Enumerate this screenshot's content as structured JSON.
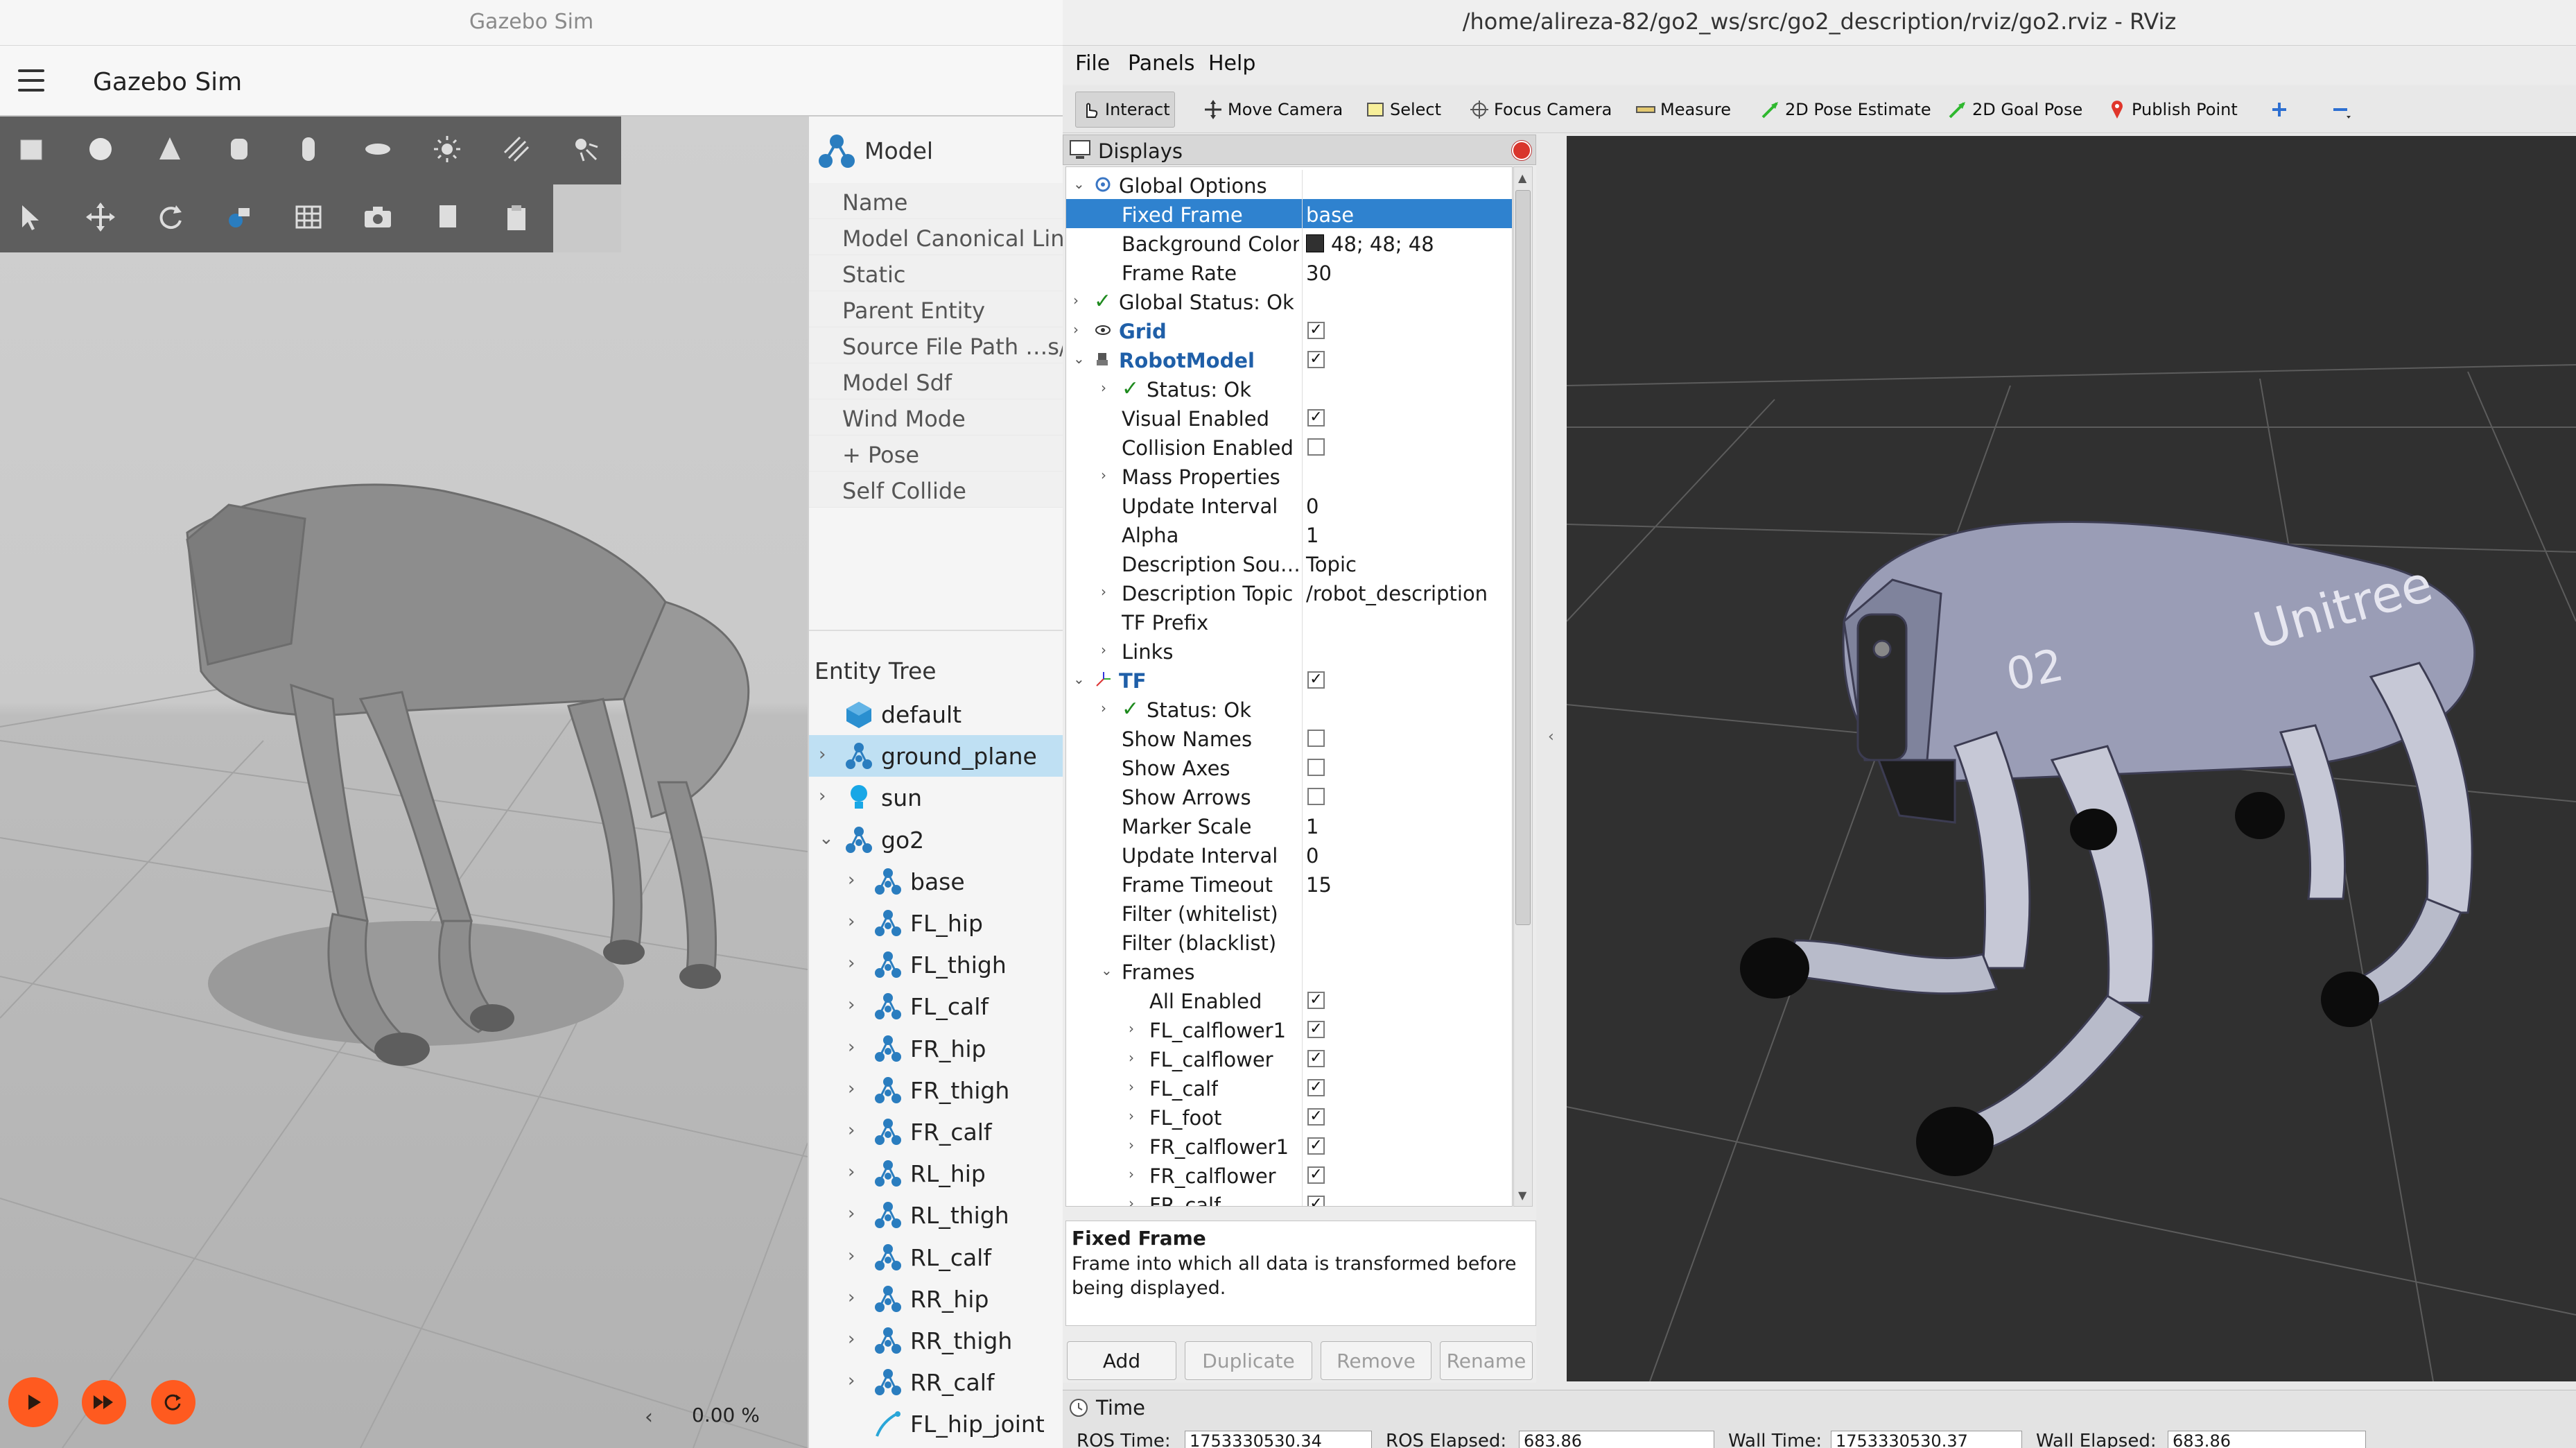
{
  "gazebo": {
    "window_title": "Gazebo Sim",
    "app_title": "Gazebo Sim",
    "toolbar_icons": [
      "box-icon",
      "sphere-icon",
      "cone-icon",
      "cylinder-icon",
      "capsule-icon",
      "ellipsoid-icon",
      "light-icon",
      "directional-light-icon",
      "spot-light-icon",
      "select-icon",
      "translate-icon",
      "rotate-icon",
      "transform-icon",
      "grid-icon",
      "camera-icon",
      "copy-icon",
      "paste-icon"
    ],
    "rtf": "0.00 %",
    "controls": [
      "play-icon",
      "step-icon",
      "reset-icon"
    ],
    "component_inspector": {
      "title": "Model",
      "properties": [
        "Name",
        "Model Canonical Link",
        "Static",
        "Parent Entity",
        "Source File Path  …s/g",
        "Model Sdf",
        "Wind Mode",
        "+ Pose",
        "Self Collide"
      ]
    },
    "entity_tree": {
      "title": "Entity Tree",
      "items": [
        {
          "label": "default",
          "icon": "world-icon",
          "level": 0,
          "expand": ""
        },
        {
          "label": "ground_plane",
          "icon": "model-icon",
          "level": 0,
          "expand": "›",
          "selected": true
        },
        {
          "label": "sun",
          "icon": "light-bulb-icon",
          "level": 0,
          "expand": "›"
        },
        {
          "label": "go2",
          "icon": "model-icon",
          "level": 0,
          "expand": "⌄"
        },
        {
          "label": "base",
          "icon": "link-icon",
          "level": 1,
          "expand": "›"
        },
        {
          "label": "FL_hip",
          "icon": "link-icon",
          "level": 1,
          "expand": "›"
        },
        {
          "label": "FL_thigh",
          "icon": "link-icon",
          "level": 1,
          "expand": "›"
        },
        {
          "label": "FL_calf",
          "icon": "link-icon",
          "level": 1,
          "expand": "›"
        },
        {
          "label": "FR_hip",
          "icon": "link-icon",
          "level": 1,
          "expand": "›"
        },
        {
          "label": "FR_thigh",
          "icon": "link-icon",
          "level": 1,
          "expand": "›"
        },
        {
          "label": "FR_calf",
          "icon": "link-icon",
          "level": 1,
          "expand": "›"
        },
        {
          "label": "RL_hip",
          "icon": "link-icon",
          "level": 1,
          "expand": "›"
        },
        {
          "label": "RL_thigh",
          "icon": "link-icon",
          "level": 1,
          "expand": "›"
        },
        {
          "label": "RL_calf",
          "icon": "link-icon",
          "level": 1,
          "expand": "›"
        },
        {
          "label": "RR_hip",
          "icon": "link-icon",
          "level": 1,
          "expand": "›"
        },
        {
          "label": "RR_thigh",
          "icon": "link-icon",
          "level": 1,
          "expand": "›"
        },
        {
          "label": "RR_calf",
          "icon": "link-icon",
          "level": 1,
          "expand": "›"
        },
        {
          "label": "FL_hip_joint",
          "icon": "joint-icon",
          "level": 1,
          "expand": ""
        }
      ]
    }
  },
  "rviz": {
    "window_title": "/home/alireza-82/go2_ws/src/go2_description/rviz/go2.rviz - RViz",
    "menus": [
      "File",
      "Panels",
      "Help"
    ],
    "tools": [
      "Interact",
      "Move Camera",
      "Select",
      "Focus Camera",
      "Measure",
      "2D Pose Estimate",
      "2D Goal Pose",
      "Publish Point"
    ],
    "displays_title": "Displays",
    "tree": [
      {
        "label": "Global Options",
        "level": 0,
        "exp": "⌄",
        "icon": "gear"
      },
      {
        "label": "Fixed Frame",
        "level": 1,
        "value": "base",
        "selected": true
      },
      {
        "label": "Background Color",
        "level": 1,
        "value": "48; 48; 48",
        "swatch": "#303030"
      },
      {
        "label": "Frame Rate",
        "level": 1,
        "value": "30"
      },
      {
        "label": "Global Status: Ok",
        "level": 0,
        "exp": "›",
        "check": true
      },
      {
        "label": "Grid",
        "level": 0,
        "exp": "›",
        "bold": true,
        "cb": true,
        "icon": "grid"
      },
      {
        "label": "RobotModel",
        "level": 0,
        "exp": "⌄",
        "bold": true,
        "cb": true,
        "icon": "robot"
      },
      {
        "label": "Status: Ok",
        "level": 1,
        "exp": "›",
        "check": true
      },
      {
        "label": "Visual Enabled",
        "level": 1,
        "cb": true
      },
      {
        "label": "Collision Enabled",
        "level": 1,
        "cb": false
      },
      {
        "label": "Mass Properties",
        "level": 1,
        "exp": "›"
      },
      {
        "label": "Update Interval",
        "level": 1,
        "value": "0"
      },
      {
        "label": "Alpha",
        "level": 1,
        "value": "1"
      },
      {
        "label": "Description Sou…",
        "level": 1,
        "value": "Topic"
      },
      {
        "label": "Description Topic",
        "level": 1,
        "exp": "›",
        "value": "/robot_description"
      },
      {
        "label": "TF Prefix",
        "level": 1
      },
      {
        "label": "Links",
        "level": 1,
        "exp": "›"
      },
      {
        "label": "TF",
        "level": 0,
        "exp": "⌄",
        "bold": true,
        "cb": true,
        "icon": "tf"
      },
      {
        "label": "Status: Ok",
        "level": 1,
        "exp": "›",
        "check": true
      },
      {
        "label": "Show Names",
        "level": 1,
        "cb": false
      },
      {
        "label": "Show Axes",
        "level": 1,
        "cb": false
      },
      {
        "label": "Show Arrows",
        "level": 1,
        "cb": false
      },
      {
        "label": "Marker Scale",
        "level": 1,
        "value": "1"
      },
      {
        "label": "Update Interval",
        "level": 1,
        "value": "0"
      },
      {
        "label": "Frame Timeout",
        "level": 1,
        "value": "15"
      },
      {
        "label": "Filter (whitelist)",
        "level": 1
      },
      {
        "label": "Filter (blacklist)",
        "level": 1
      },
      {
        "label": "Frames",
        "level": 1,
        "exp": "⌄"
      },
      {
        "label": "All Enabled",
        "level": 2,
        "cb": true
      },
      {
        "label": "FL_calflower1",
        "level": 2,
        "exp": "›",
        "cb": true
      },
      {
        "label": "FL_calflower",
        "level": 2,
        "exp": "›",
        "cb": true
      },
      {
        "label": "FL_calf",
        "level": 2,
        "exp": "›",
        "cb": true
      },
      {
        "label": "FL_foot",
        "level": 2,
        "exp": "›",
        "cb": true
      },
      {
        "label": "FR_calflower1",
        "level": 2,
        "exp": "›",
        "cb": true
      },
      {
        "label": "FR_calflower",
        "level": 2,
        "exp": "›",
        "cb": true
      },
      {
        "label": "FR_calf",
        "level": 2,
        "exp": "›",
        "cb": true
      }
    ],
    "description": {
      "title": "Fixed Frame",
      "body": "Frame into which all data is transformed before being displayed."
    },
    "buttons": [
      {
        "label": "Add",
        "enabled": true
      },
      {
        "label": "Duplicate",
        "enabled": false
      },
      {
        "label": "Remove",
        "enabled": false
      },
      {
        "label": "Rename",
        "enabled": false
      }
    ],
    "viewport": {
      "robot_label": "Unitree",
      "robot_id": "02"
    },
    "time": {
      "title": "Time",
      "fields": [
        {
          "label": "ROS Time:",
          "value": "1753330530.34"
        },
        {
          "label": "ROS Elapsed:",
          "value": "683.86"
        },
        {
          "label": "Wall Time:",
          "value": "1753330530.37"
        },
        {
          "label": "Wall Elapsed:",
          "value": "683.86"
        }
      ]
    }
  }
}
